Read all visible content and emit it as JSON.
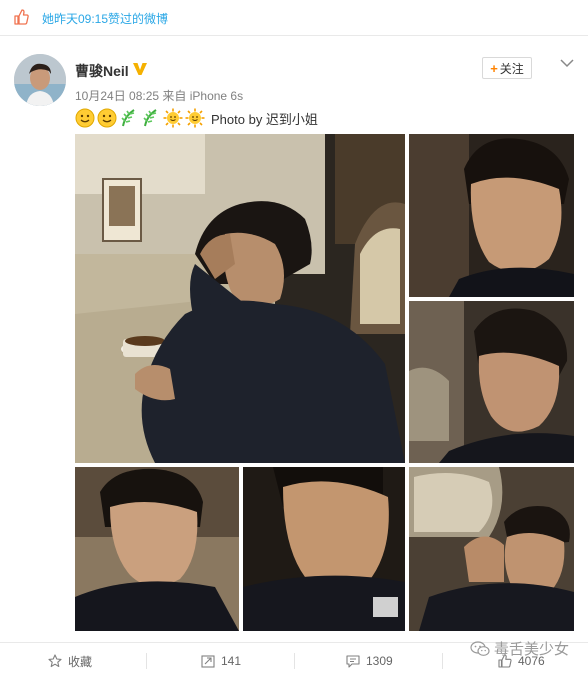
{
  "liked_bar": {
    "text": "她昨天09:15赞过的微博"
  },
  "post": {
    "username": "曹骏Neil",
    "meta": "10月24日 08:25 来自 iPhone 6s",
    "follow_label": "关注",
    "text": "Photo by 迟到小姐"
  },
  "actions": {
    "favorite_label": "收藏",
    "repost_count": "141",
    "comment_count": "1309",
    "like_count": "4076"
  },
  "watermark": {
    "text": "毒舌美少女"
  },
  "colors": {
    "link_blue": "#2aa7e6",
    "brand_orange": "#ff8200",
    "verified_gold": "#f5b100"
  },
  "icons": [
    "thumbs-up-icon",
    "verified-v-icon",
    "chevron-down-icon",
    "smile-emoji",
    "leaf-emoji",
    "sun-emoji",
    "star-icon",
    "repost-icon",
    "comment-icon",
    "like-icon",
    "wechat-icon"
  ]
}
